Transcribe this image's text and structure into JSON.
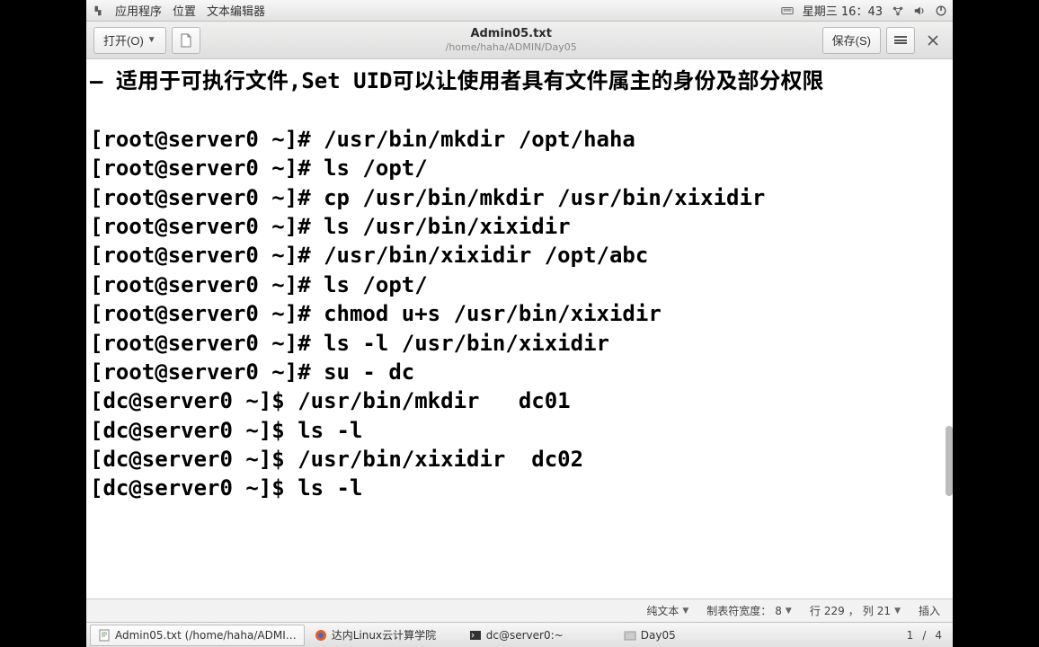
{
  "top_panel": {
    "apps": "应用程序",
    "places": "位置",
    "text_editor": "文本编辑器",
    "clock": "星期三 16：43"
  },
  "editor": {
    "open_label": "打开(O)",
    "save_label": "保存(S)",
    "title": "Admin05.txt",
    "subtitle": "/home/haha/ADMIN/Day05",
    "lines": [
      "– 适用于可执行文件,Set UID可以让使用者具有文件属主的身份及部分权限",
      "",
      "[root@server0 ~]# /usr/bin/mkdir /opt/haha",
      "[root@server0 ~]# ls /opt/",
      "[root@server0 ~]# cp /usr/bin/mkdir /usr/bin/xixidir",
      "[root@server0 ~]# ls /usr/bin/xixidir",
      "[root@server0 ~]# /usr/bin/xixidir /opt/abc",
      "[root@server0 ~]# ls /opt/",
      "[root@server0 ~]# chmod u+s /usr/bin/xixidir",
      "[root@server0 ~]# ls -l /usr/bin/xixidir",
      "[root@server0 ~]# su - dc",
      "[dc@server0 ~]$ /usr/bin/mkdir   dc01",
      "[dc@server0 ~]$ ls -l",
      "[dc@server0 ~]$ /usr/bin/xixidir  dc02",
      "[dc@server0 ~]$ ls -l"
    ]
  },
  "status": {
    "lang": "纯文本",
    "tab_width_label": "制表符宽度：",
    "tab_width_value": "8",
    "line_label": "行",
    "line_value": "229",
    "col_label": "列",
    "col_value": "21",
    "mode": "插入"
  },
  "taskbar": {
    "items": [
      "Admin05.txt (/home/haha/ADMI…",
      "达内Linux云计算学院",
      "dc@server0:~",
      "Day05"
    ],
    "page_current": "1",
    "page_total": "4"
  }
}
